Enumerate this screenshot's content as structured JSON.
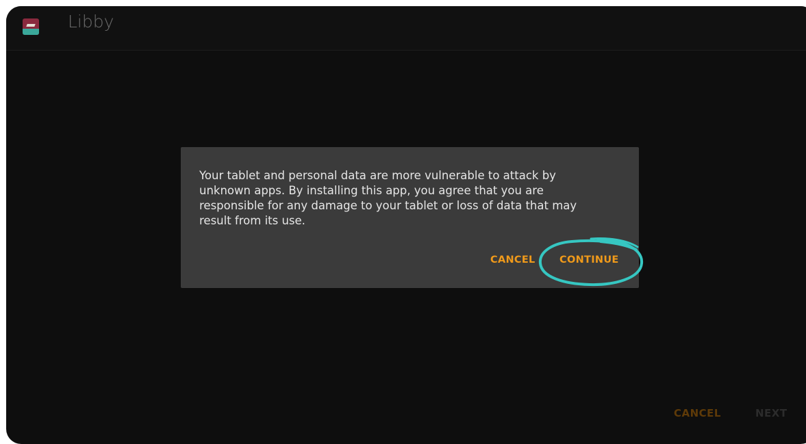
{
  "app": {
    "title": "Libby",
    "icon": "libby-app-icon"
  },
  "dialog": {
    "message": "Your tablet and personal data are more vulnerable to attack by unknown apps. By installing this app, you agree that you are responsible for any damage to your tablet or loss of data that may result from its use.",
    "cancel_label": "CANCEL",
    "continue_label": "CONTINUE"
  },
  "footer": {
    "cancel_label": "CANCEL",
    "next_label": "NEXT"
  },
  "colors": {
    "accent": "#f09a1a",
    "annotation": "#36c7c2",
    "dialog_bg": "#3b3b3b",
    "screen_bg": "#0e0e0e"
  }
}
